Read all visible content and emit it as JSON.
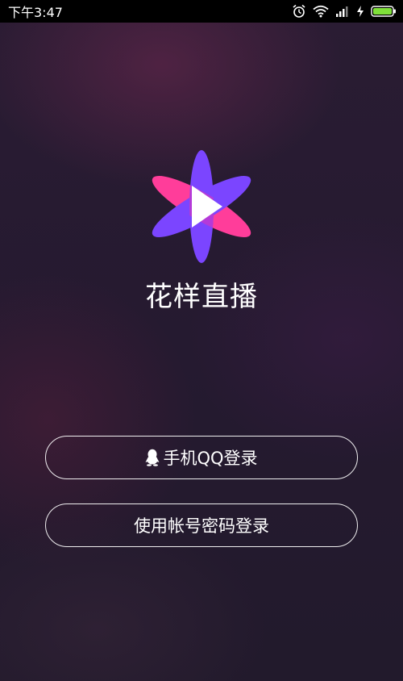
{
  "status_bar": {
    "time": "下午3:47",
    "icons": [
      "alarm-icon",
      "wifi-icon",
      "signal-icon",
      "charging-icon",
      "battery-icon"
    ],
    "battery_color": "#7fe03a"
  },
  "app": {
    "name": "花样直播",
    "logo_colors": {
      "purple": "#7b45ff",
      "pink": "#ff3d9a",
      "overlap": "#b43ad8",
      "play": "#ffffff"
    }
  },
  "buttons": {
    "qq_login": "手机QQ登录",
    "account_login": "使用帐号密码登录"
  },
  "icons": {
    "qq": "qq-penguin-icon"
  }
}
